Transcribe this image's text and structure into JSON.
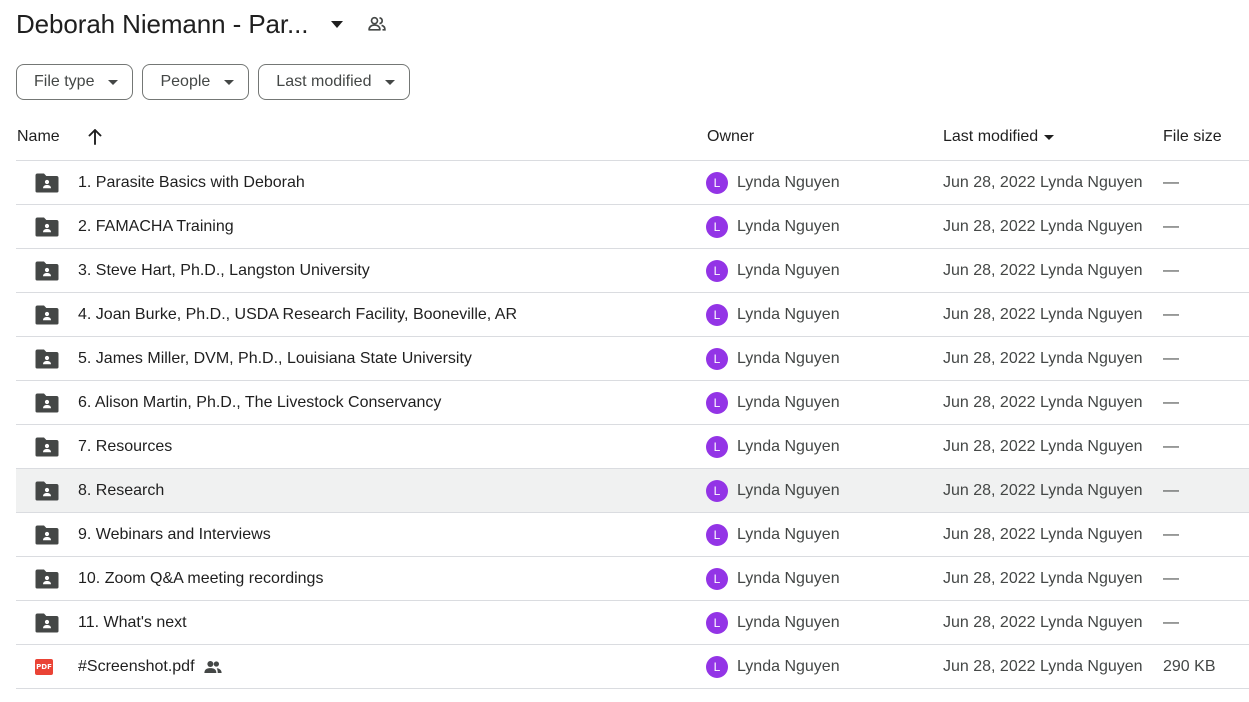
{
  "header": {
    "title": "Deborah Niemann - Par..."
  },
  "filters": [
    {
      "label": "File type"
    },
    {
      "label": "People"
    },
    {
      "label": "Last modified"
    }
  ],
  "columns": {
    "name": "Name",
    "owner": "Owner",
    "last_modified": "Last modified",
    "file_size": "File size"
  },
  "colors": {
    "avatar": "#9334e6",
    "row_highlight": "#f0f1f1",
    "pdf": "#ea4335"
  },
  "rows": [
    {
      "type": "folder",
      "name": "1. Parasite Basics with Deborah",
      "owner_initial": "L",
      "owner": "Lynda Nguyen",
      "modified": "Jun 28, 2022 Lynda Nguyen",
      "size": "—"
    },
    {
      "type": "folder",
      "name": "2. FAMACHA Training",
      "owner_initial": "L",
      "owner": "Lynda Nguyen",
      "modified": "Jun 28, 2022 Lynda Nguyen",
      "size": "—"
    },
    {
      "type": "folder",
      "name": "3. Steve Hart, Ph.D., Langston University",
      "owner_initial": "L",
      "owner": "Lynda Nguyen",
      "modified": "Jun 28, 2022 Lynda Nguyen",
      "size": "—"
    },
    {
      "type": "folder",
      "name": "4. Joan Burke, Ph.D., USDA Research Facility, Booneville, AR",
      "owner_initial": "L",
      "owner": "Lynda Nguyen",
      "modified": "Jun 28, 2022 Lynda Nguyen",
      "size": "—"
    },
    {
      "type": "folder",
      "name": "5. James Miller, DVM, Ph.D., Louisiana State University",
      "owner_initial": "L",
      "owner": "Lynda Nguyen",
      "modified": "Jun 28, 2022 Lynda Nguyen",
      "size": "—"
    },
    {
      "type": "folder",
      "name": "6. Alison Martin, Ph.D., The Livestock Conservancy",
      "owner_initial": "L",
      "owner": "Lynda Nguyen",
      "modified": "Jun 28, 2022 Lynda Nguyen",
      "size": "—"
    },
    {
      "type": "folder",
      "name": "7. Resources",
      "owner_initial": "L",
      "owner": "Lynda Nguyen",
      "modified": "Jun 28, 2022 Lynda Nguyen",
      "size": "—"
    },
    {
      "type": "folder",
      "name": "8. Research",
      "owner_initial": "L",
      "owner": "Lynda Nguyen",
      "modified": "Jun 28, 2022 Lynda Nguyen",
      "size": "—",
      "highlighted": true
    },
    {
      "type": "folder",
      "name": "9. Webinars and Interviews",
      "owner_initial": "L",
      "owner": "Lynda Nguyen",
      "modified": "Jun 28, 2022 Lynda Nguyen",
      "size": "—"
    },
    {
      "type": "folder",
      "name": "10. Zoom Q&A meeting recordings",
      "owner_initial": "L",
      "owner": "Lynda Nguyen",
      "modified": "Jun 28, 2022 Lynda Nguyen",
      "size": "—"
    },
    {
      "type": "folder",
      "name": "11. What's next",
      "owner_initial": "L",
      "owner": "Lynda Nguyen",
      "modified": "Jun 28, 2022 Lynda Nguyen",
      "size": "—"
    },
    {
      "type": "pdf",
      "name": "#Screenshot.pdf",
      "shared": true,
      "icon_label": "PDF",
      "owner_initial": "L",
      "owner": "Lynda Nguyen",
      "modified": "Jun 28, 2022 Lynda Nguyen",
      "size": "290 KB"
    }
  ]
}
